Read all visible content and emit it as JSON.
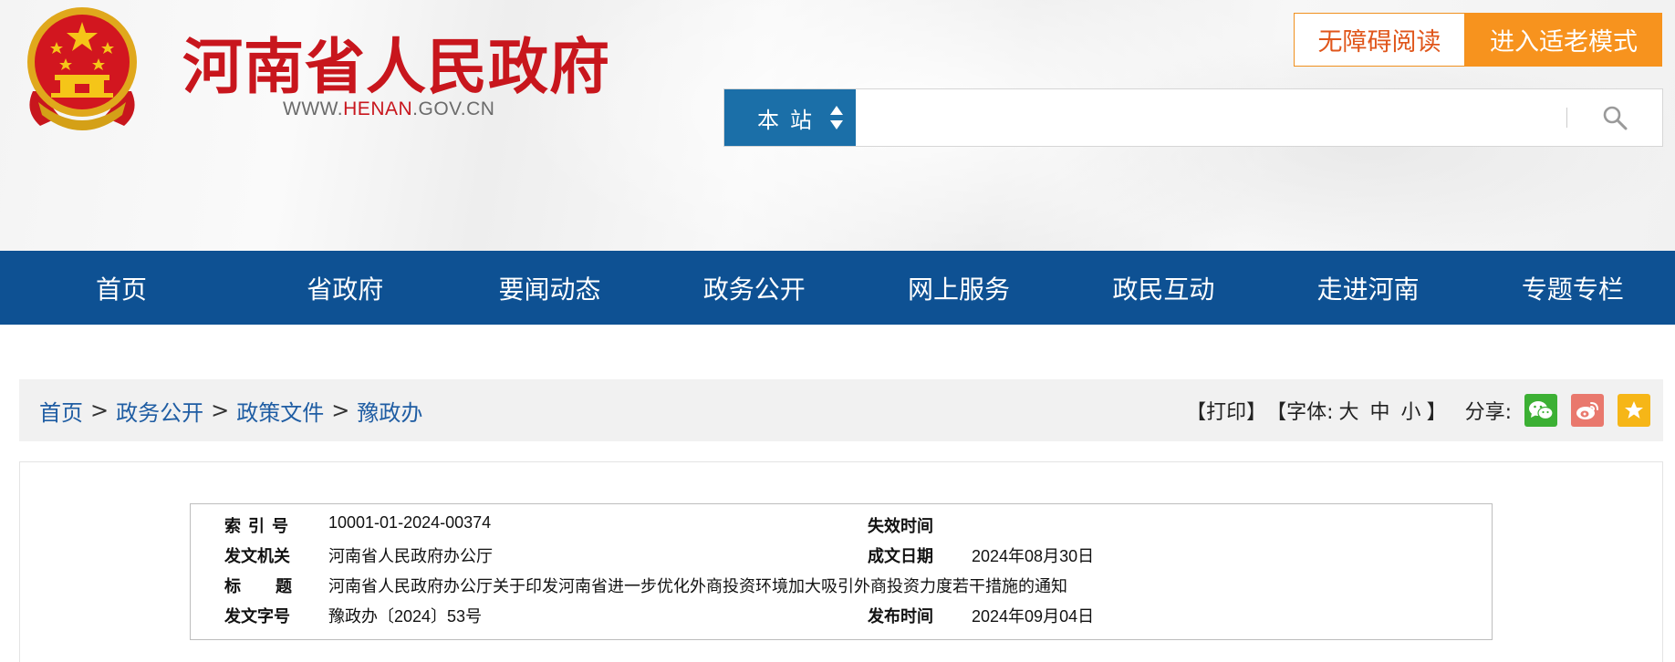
{
  "header": {
    "site_title": "河南省人民政府",
    "url_prefix": "WWW.",
    "url_highlight": "HENAN",
    "url_suffix": ".GOV.CN",
    "accessibility_label": "无障碍阅读",
    "elder_mode_label": "进入适老模式",
    "emblem_icon": "national-emblem-icon"
  },
  "search": {
    "scope_label": "本站",
    "placeholder": "",
    "value": "",
    "icon": "search-icon"
  },
  "nav": {
    "items": [
      "首页",
      "省政府",
      "要闻动态",
      "政务公开",
      "网上服务",
      "政民互动",
      "走进河南",
      "专题专栏"
    ]
  },
  "breadcrumb": {
    "items": [
      "首页",
      "政务公开",
      "政策文件",
      "豫政办"
    ],
    "separator": ">"
  },
  "tools": {
    "print": "【打印】",
    "font_prefix": "【字体:",
    "font_large": "大",
    "font_medium": "中",
    "font_small": "小",
    "font_suffix": "】",
    "share_label": "分享:",
    "share_icons": [
      "wechat-icon",
      "weibo-icon",
      "favorite-star-icon"
    ]
  },
  "colors": {
    "title_red": "#c8161d",
    "nav_blue": "#0e5193",
    "scope_blue": "#1b6fa8",
    "elder_orange": "#f7931e",
    "link_blue": "#1f5da3"
  },
  "document_meta": {
    "index_label": "索引号",
    "index_value": "10001-01-2024-00374",
    "expire_label": "失效时间",
    "expire_value": "",
    "issuer_label": "发文机关",
    "issuer_value": "河南省人民政府办公厅",
    "created_label": "成文日期",
    "created_value": "2024年08月30日",
    "title_label": "标题",
    "title_value": "河南省人民政府办公厅关于印发河南省进一步优化外商投资环境加大吸引外商投资力度若干措施的通知",
    "docno_label": "发文字号",
    "docno_value": "豫政办〔2024〕53号",
    "published_label": "发布时间",
    "published_value": "2024年09月04日"
  }
}
